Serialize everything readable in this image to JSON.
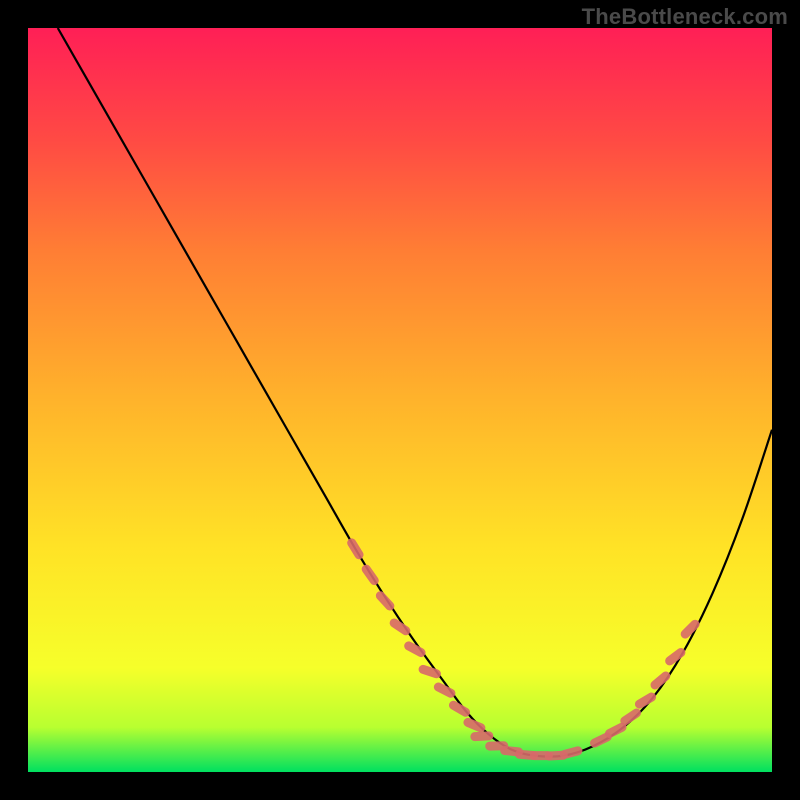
{
  "watermark": "TheBottleneck.com",
  "chart_data": {
    "type": "line",
    "title": "",
    "xlabel": "",
    "ylabel": "",
    "xlim": [
      0,
      100
    ],
    "ylim": [
      0,
      100
    ],
    "gradient_stops": [
      {
        "offset": 0.0,
        "color": "#00e060"
      },
      {
        "offset": 0.06,
        "color": "#b8ff30"
      },
      {
        "offset": 0.14,
        "color": "#f6ff2a"
      },
      {
        "offset": 0.3,
        "color": "#ffe326"
      },
      {
        "offset": 0.5,
        "color": "#ffb32b"
      },
      {
        "offset": 0.7,
        "color": "#ff7e34"
      },
      {
        "offset": 0.85,
        "color": "#ff4a44"
      },
      {
        "offset": 1.0,
        "color": "#ff1f56"
      }
    ],
    "series": [
      {
        "name": "curve",
        "color": "#000000",
        "x": [
          4,
          8,
          12,
          16,
          20,
          24,
          28,
          32,
          36,
          40,
          44,
          48,
          52,
          56,
          59,
          62,
          65,
          68,
          72,
          76,
          80,
          84,
          88,
          92,
          96,
          100
        ],
        "y": [
          100,
          93,
          86,
          79,
          72,
          65,
          58,
          51,
          44,
          37,
          30,
          23.5,
          17.5,
          12,
          8,
          5,
          3,
          2.2,
          2.2,
          3.5,
          6,
          10,
          16,
          24,
          34,
          46
        ]
      }
    ],
    "overlays": [
      {
        "name": "dotted-left",
        "color": "#d86a6a",
        "style": "dotted",
        "points": [
          {
            "x": 44,
            "y": 30
          },
          {
            "x": 46,
            "y": 26.5
          },
          {
            "x": 48,
            "y": 23
          },
          {
            "x": 50,
            "y": 19.5
          },
          {
            "x": 52,
            "y": 16.5
          },
          {
            "x": 54,
            "y": 13.5
          },
          {
            "x": 56,
            "y": 11
          },
          {
            "x": 58,
            "y": 8.5
          },
          {
            "x": 60,
            "y": 6.3
          }
        ]
      },
      {
        "name": "dotted-bottom",
        "color": "#d86a6a",
        "style": "dotted",
        "points": [
          {
            "x": 61,
            "y": 4.8
          },
          {
            "x": 63,
            "y": 3.5
          },
          {
            "x": 65,
            "y": 2.8
          },
          {
            "x": 67,
            "y": 2.3
          },
          {
            "x": 69,
            "y": 2.2
          },
          {
            "x": 71,
            "y": 2.2
          },
          {
            "x": 73,
            "y": 2.6
          }
        ]
      },
      {
        "name": "dotted-right",
        "color": "#d86a6a",
        "style": "dotted",
        "points": [
          {
            "x": 77,
            "y": 4.3
          },
          {
            "x": 79,
            "y": 5.6
          },
          {
            "x": 81,
            "y": 7.4
          },
          {
            "x": 83,
            "y": 9.6
          },
          {
            "x": 85,
            "y": 12.3
          },
          {
            "x": 87,
            "y": 15.5
          },
          {
            "x": 89,
            "y": 19.2
          }
        ]
      }
    ]
  }
}
